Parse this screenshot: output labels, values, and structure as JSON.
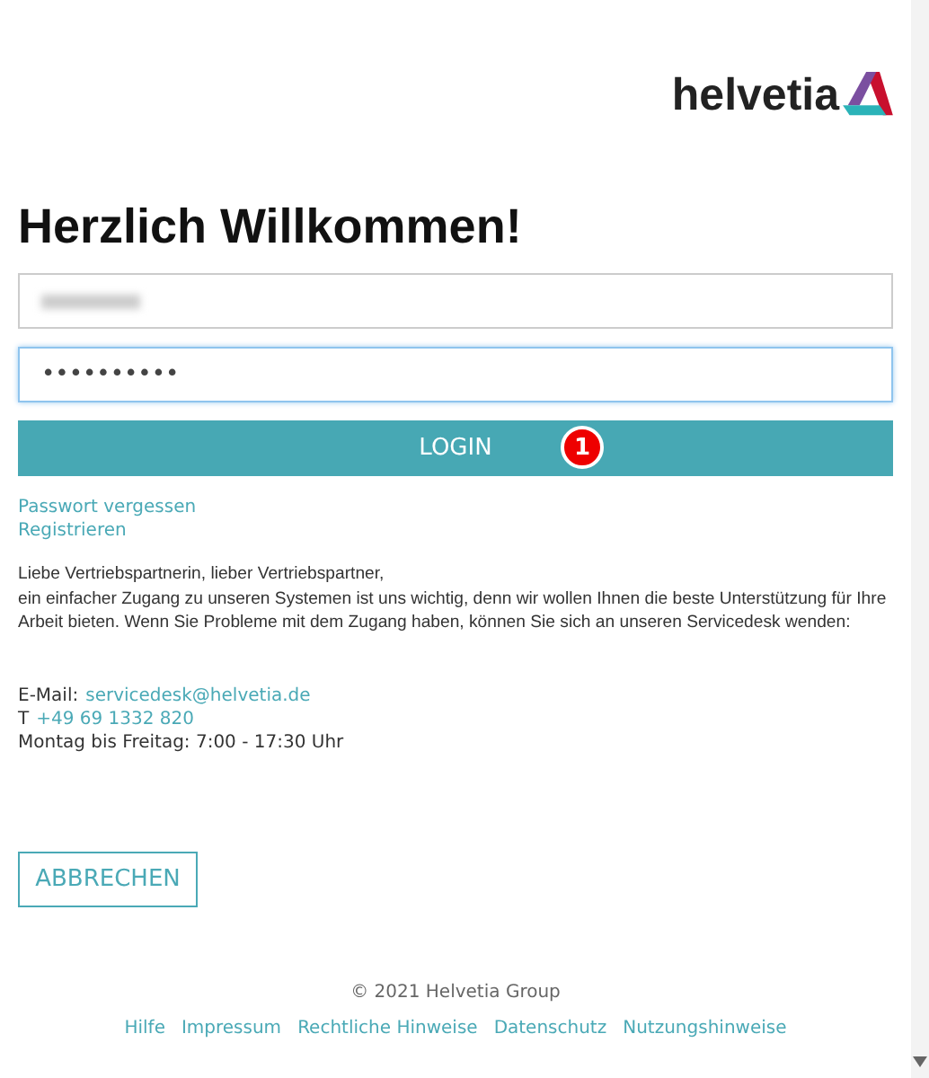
{
  "logo": {
    "text": "helvetia"
  },
  "title": "Herzlich Willkommen!",
  "fields": [
    {
      "kind": "username",
      "value_redacted": true,
      "focused": false
    },
    {
      "kind": "password",
      "value": "••••••••••",
      "focused": true
    }
  ],
  "login_button": {
    "label": "LOGIN",
    "badge": "1"
  },
  "links": [
    "Passwort vergessen",
    "Registrieren"
  ],
  "intro": [
    "Liebe Vertriebspartnerin, lieber Vertriebspartner,",
    "ein einfacher Zugang zu unseren Systemen ist uns wichtig, denn wir wollen Ihnen die beste Unterstützung für Ihre Arbeit bieten. Wenn Sie Probleme mit dem Zugang haben, können Sie sich an unseren Servicedesk wenden:"
  ],
  "contact": {
    "email_label": "E-Mail:",
    "email": "servicedesk@helvetia.de",
    "phone_label": "T",
    "phone": "+49 69 1332 820",
    "hours": "Montag bis Freitag: 7:00 - 17:30 Uhr"
  },
  "cancel_button": "ABBRECHEN",
  "footer": {
    "copyright": "© 2021 Helvetia Group",
    "links": [
      "Hilfe",
      "Impressum",
      "Rechtliche Hinweise",
      "Datenschutz",
      "Nutzungshinweise"
    ]
  }
}
